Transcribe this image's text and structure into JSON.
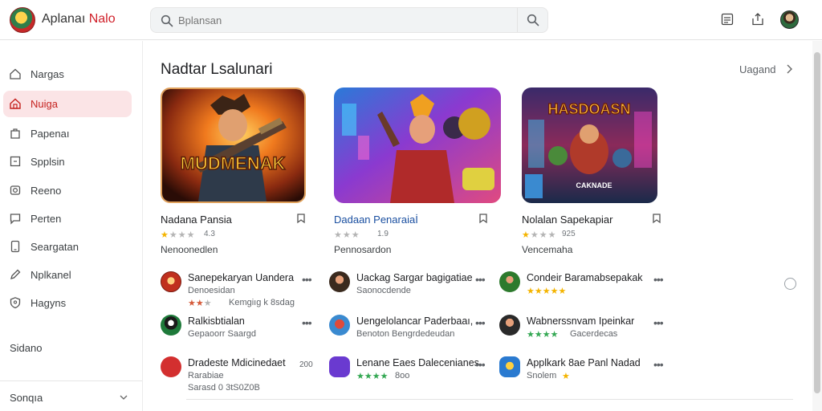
{
  "header": {
    "brand_main": "Aplanaı ",
    "brand_accent": "Nalo",
    "search_placeholder": "Bplansan"
  },
  "sidebar": {
    "items": [
      {
        "label": "Nargas",
        "icon": "home-icon"
      },
      {
        "label": "Nuiga",
        "icon": "home-icon",
        "active": true
      },
      {
        "label": "Papenaı",
        "icon": "bag-icon"
      },
      {
        "label": "Spplsin",
        "icon": "square-icon"
      },
      {
        "label": "Reeno",
        "icon": "camera-icon"
      },
      {
        "label": "Perten",
        "icon": "chat-icon"
      },
      {
        "label": "Seargatan",
        "icon": "tablet-icon"
      },
      {
        "label": "Nplkanel",
        "icon": "pen-icon"
      },
      {
        "label": "Hagyns",
        "icon": "shield-icon"
      }
    ],
    "section_label": "Sidano",
    "footer_label": "Sonqıa"
  },
  "main": {
    "section_title": "Nadtar Lsalunari",
    "more_label": "Uagand",
    "featured": [
      {
        "title": "Nadana Pansia",
        "rating": "4.3",
        "subtitle": "Nenoonedlen",
        "banner": "MUDMENAK",
        "stars_on": 1
      },
      {
        "title": "Dadaan Penaraiaİ",
        "rating": "1.9",
        "subtitle": "Pennosardon",
        "banner": "",
        "stars_on": 0
      },
      {
        "title": "Nolalan Sapekapiar",
        "rating": "925",
        "subtitle": "Vencemaha",
        "banner": "HASDOASN",
        "banner2": "CAKNADE",
        "stars_on": 1
      }
    ],
    "list": [
      {
        "title": "Sanepekaryan Uandera",
        "sub": "Denoesidan",
        "sub2": "Kemgiıg k 8sdag"
      },
      {
        "title": "Uackag Sargar bagigatiae",
        "sub": "Saonocdende",
        "sub2": ""
      },
      {
        "title": "Condeir Baramabsepakak",
        "sub": "",
        "sub2": ""
      },
      {
        "title": "Ralkisbtialan",
        "sub": "Gepaoorr Saargd",
        "sub2": ""
      },
      {
        "title": "Uengelolancar Paderbaaı,",
        "sub": "Benoton Bengrdedeudan",
        "sub2": ""
      },
      {
        "title": "Wabnerssnvam Ipeinkar",
        "sub": "Gacerdecas",
        "sub2": ""
      },
      {
        "title": "Dradeste Mdicinedaet",
        "sub": "Rarabiae",
        "sub2": "Sarasd 0 3tS0Z0B",
        "extra": "200"
      },
      {
        "title": "Lenane Eaes Dalecenianes",
        "sub": "8oo",
        "sub2": ""
      },
      {
        "title": "Applkark 8ae Panl Nadad",
        "sub": "Snolem",
        "sub2": ""
      }
    ]
  }
}
